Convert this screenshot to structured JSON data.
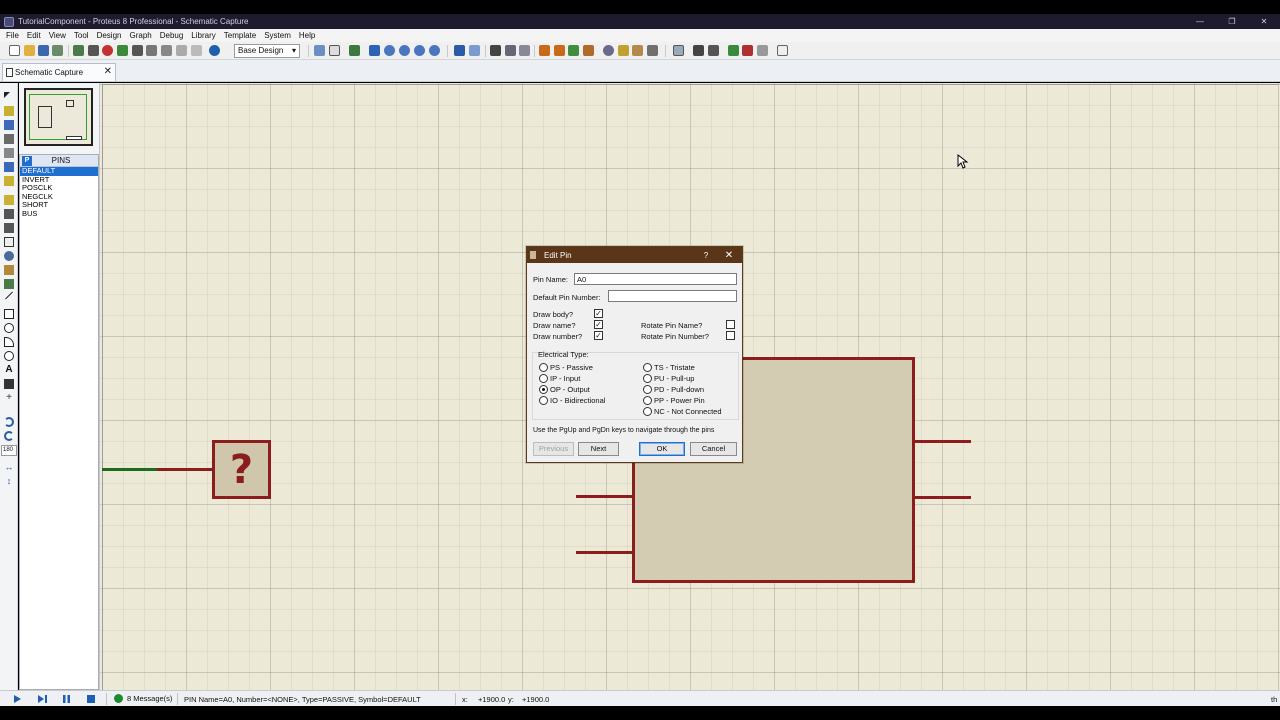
{
  "window": {
    "title": "TutorialComponent - Proteus 8 Professional - Schematic Capture",
    "minimize": "—",
    "maximize": "❐",
    "close": "✕"
  },
  "menu": [
    "File",
    "Edit",
    "View",
    "Tool",
    "Design",
    "Graph",
    "Debug",
    "Library",
    "Template",
    "System",
    "Help"
  ],
  "toolbar": {
    "design_select": "Base Design",
    "select_arrow": "▾"
  },
  "tab": {
    "label": "Schematic Capture",
    "close": "✕"
  },
  "left_tools": {
    "rotation_value": "180"
  },
  "pins_panel": {
    "badge": "P",
    "title": "PINS",
    "items": [
      "DEFAULT",
      "INVERT",
      "POSCLK",
      "NEGCLK",
      "SHORT",
      "BUS"
    ],
    "selected_index": 0
  },
  "canvas": {
    "placeholder_glyph": "?"
  },
  "dialog": {
    "title": "Edit Pin",
    "help": "?",
    "close": "✕",
    "pin_name_label": "Pin Name:",
    "pin_name_value": "A0",
    "default_pin_number_label": "Default Pin Number:",
    "default_pin_number_value": "",
    "draw_body_label": "Draw body?",
    "draw_body_checked": true,
    "draw_name_label": "Draw name?",
    "draw_name_checked": true,
    "draw_number_label": "Draw number?",
    "draw_number_checked": true,
    "rotate_pin_name_label": "Rotate Pin Name?",
    "rotate_pin_name_checked": false,
    "rotate_pin_number_label": "Rotate Pin Number?",
    "rotate_pin_number_checked": false,
    "electrical_type_label": "Electrical Type:",
    "electrical_types_left": [
      "PS - Passive",
      "IP - Input",
      "OP - Output",
      "IO - Bidirectional"
    ],
    "electrical_types_right": [
      "TS - Tristate",
      "PU - Pull-up",
      "PD - Pull-down",
      "PP - Power Pin",
      "NC - Not Connected"
    ],
    "selected_type": "OP - Output",
    "hint": "Use the PgUp and PgDn keys to navigate through the pins",
    "previous_label": "Previous",
    "next_label": "Next",
    "ok_label": "OK",
    "cancel_label": "Cancel",
    "check_mark": "✓"
  },
  "statusbar": {
    "messages": "8 Message(s)",
    "info": "PIN Name=A0, Number=<NONE>, Type=PASSIVE, Symbol=DEFAULT",
    "x_label": "x:",
    "x_value": "+1900.0",
    "y_label": "y:",
    "y_value": "+1900.0",
    "right_text": "th"
  },
  "colors": {
    "wire": "#8b1d1d",
    "title_bar": "#1f1b2e",
    "dialog_title": "#5b3518",
    "selection": "#1f6fd0",
    "canvas": "#ece9d7"
  }
}
